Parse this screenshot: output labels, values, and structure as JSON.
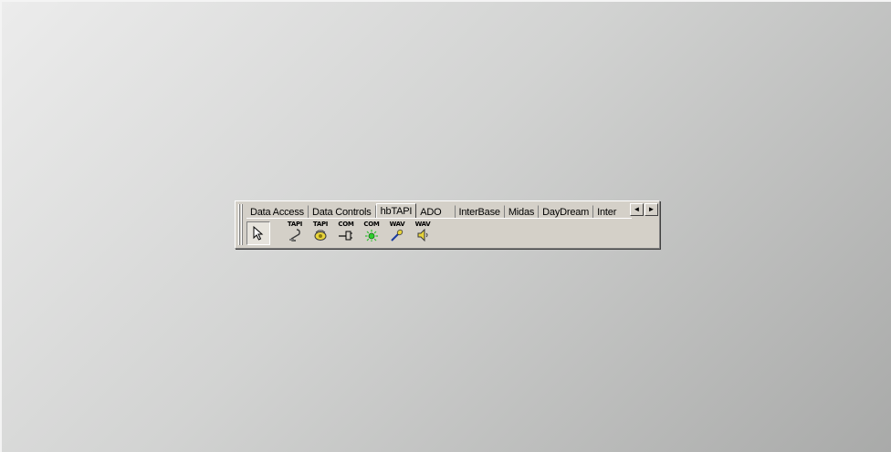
{
  "palette": {
    "tabs": [
      {
        "label": "Data Access"
      },
      {
        "label": "Data Controls"
      },
      {
        "label": "hbTAPI",
        "active": true
      },
      {
        "label": "ADO"
      },
      {
        "label": "InterBase"
      },
      {
        "label": "Midas"
      },
      {
        "label": "DayDream"
      },
      {
        "label": "Inter"
      }
    ],
    "scroll_left": "◄",
    "scroll_right": "►",
    "components": [
      {
        "label": "TAPI",
        "icon": "tapi-phone-icon"
      },
      {
        "label": "TAPI",
        "icon": "tapi-line-icon"
      },
      {
        "label": "COM",
        "icon": "com-plug-icon"
      },
      {
        "label": "COM",
        "icon": "com-light-icon"
      },
      {
        "label": "WAV",
        "icon": "wav-microphone-icon"
      },
      {
        "label": "WAV",
        "icon": "wav-speaker-icon"
      }
    ]
  }
}
